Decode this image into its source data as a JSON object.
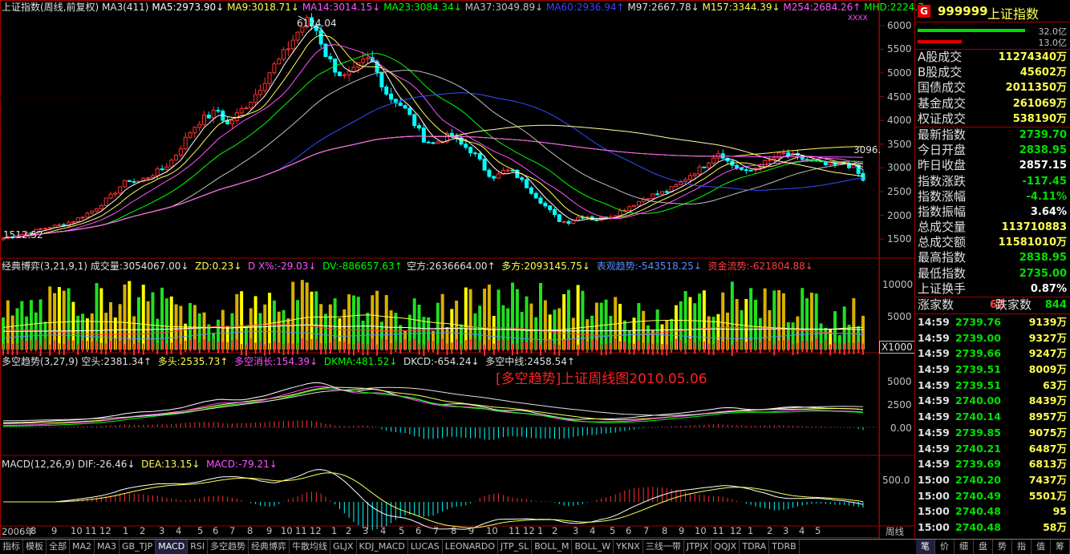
{
  "main_overlay": {
    "title": "上证指数(周线,前复权)",
    "ma3": "MA3(411)",
    "ma5": "MA5:2973.90↓",
    "ma9": "MA9:3018.71↓",
    "ma14": "MA14:3014.15↓",
    "ma23": "MA23:3084.34↓",
    "ma37": "MA37:3049.89↓",
    "ma60": "MA60:2936.94↑",
    "ma97": "M97:2667.78↓",
    "m157": "M157:3344.39↓",
    "m254": "M254:2684.26↑",
    "mhd": "MHD:2224.7:",
    "xxxx": "XXXX",
    "high_label": "6124.04",
    "low_label": "1512.52",
    "right_label": "3096."
  },
  "price_axis": [
    "6000",
    "5500",
    "5000",
    "4500",
    "4000",
    "3500",
    "3000",
    "2500",
    "2000",
    "1500"
  ],
  "vol_overlay": {
    "name": "经典博弈(3,21,9,1)",
    "vol": "成交量:3054067.00↓",
    "zd": "ZD:0.23↓",
    "dx": "D X%:-29.03↓",
    "dv": "DV:-886657.63↑",
    "kf": "空方:2636664.00↑",
    "df": "多方:2093145.75↓",
    "bx": "表观趋势:-543518.25↓",
    "zj": "资金流势:-621804.88↓"
  },
  "vol_axis": [
    "10000",
    "5000"
  ],
  "vol_unit": "X1000",
  "trend_overlay": {
    "name": "多空趋势(3,27,9)",
    "kt": "空头:2381.34↑",
    "dt": "多头:2535.73↑",
    "xz": "多空消长:154.39↓",
    "dkma": "DKMA:481.52↓",
    "dkcd": "DKCD:-654.24↓",
    "zx": "多空中线:2458.54↑"
  },
  "trend_caption": "[多空趋势]上证周线图2010.05.06",
  "trend_axis": [
    "5000",
    "2500",
    "0.00"
  ],
  "macd_overlay": {
    "name": "MACD(12,26,9)",
    "dif": "DIF:-26.46↓",
    "dea": "DEA:13.15↓",
    "macd": "MACD:-79.21↓"
  },
  "macd_axis": [
    "500.0"
  ],
  "x_axis": {
    "year": "2006年",
    "months": [
      "8",
      "9",
      "10",
      "11",
      "12",
      "1",
      "2",
      "3",
      "4",
      "5",
      "6",
      "7",
      "8",
      "9",
      "10",
      "11",
      "12",
      "1",
      "2",
      "3",
      "4",
      "5",
      "6",
      "7",
      "8",
      "9",
      "10",
      "11",
      "12",
      "1",
      "2",
      "3",
      "4",
      "5",
      "6",
      "7",
      "8",
      "9",
      "10",
      "11",
      "12",
      "1",
      "2",
      "3",
      "4",
      "5"
    ],
    "period": "周线"
  },
  "right_panel": {
    "code": "999999",
    "name": "上证指数",
    "g": "G",
    "bar1": "32.0亿",
    "bar2": "13.0亿",
    "stats": [
      {
        "l": "A股成交",
        "v": "11274340万",
        "c": "#ffff54"
      },
      {
        "l": "B股成交",
        "v": "45602万",
        "c": "#ffff54"
      },
      {
        "l": "国债成交",
        "v": "2011350万",
        "c": "#ffff54"
      },
      {
        "l": "基金成交",
        "v": "261069万",
        "c": "#ffff54"
      },
      {
        "l": "权证成交",
        "v": "538190万",
        "c": "#ffff54"
      }
    ],
    "quote": [
      {
        "l": "最新指数",
        "v": "2739.70",
        "c": "#00e000"
      },
      {
        "l": "今日开盘",
        "v": "2838.95",
        "c": "#00e000"
      },
      {
        "l": "昨日收盘",
        "v": "2857.15",
        "c": "#ffffff"
      },
      {
        "l": "指数涨跌",
        "v": "-117.45",
        "c": "#00e000"
      },
      {
        "l": "指数涨幅",
        "v": "-4.11%",
        "c": "#00e000"
      },
      {
        "l": "指数振幅",
        "v": "3.64%",
        "c": "#ffffff"
      },
      {
        "l": "总成交量",
        "v": "113710883",
        "c": "#ffff54"
      },
      {
        "l": "总成交额",
        "v": "11581010万",
        "c": "#ffff54"
      },
      {
        "l": "最高指数",
        "v": "2838.95",
        "c": "#00e000"
      },
      {
        "l": "最低指数",
        "v": "2735.00",
        "c": "#00e000"
      },
      {
        "l": "上证换手",
        "v": "0.87%",
        "c": "#ffffff"
      }
    ],
    "updown": {
      "up_l": "涨家数",
      "up": "62",
      "dn_l": "跌家数",
      "dn": "844"
    },
    "ticks": [
      {
        "t": "14:59",
        "p": "2739.76",
        "q": "9139万"
      },
      {
        "t": "14:59",
        "p": "2739.00",
        "q": "9327万"
      },
      {
        "t": "14:59",
        "p": "2739.66",
        "q": "9247万"
      },
      {
        "t": "14:59",
        "p": "2739.51",
        "q": "8009万"
      },
      {
        "t": "14:59",
        "p": "2739.51",
        "q": "63万"
      },
      {
        "t": "14:59",
        "p": "2740.00",
        "q": "8439万"
      },
      {
        "t": "14:59",
        "p": "2740.14",
        "q": "8957万"
      },
      {
        "t": "14:59",
        "p": "2739.85",
        "q": "9075万"
      },
      {
        "t": "14:59",
        "p": "2740.21",
        "q": "6487万"
      },
      {
        "t": "14:59",
        "p": "2739.69",
        "q": "6813万"
      },
      {
        "t": "15:00",
        "p": "2740.20",
        "q": "7437万"
      },
      {
        "t": "15:00",
        "p": "2740.49",
        "q": "5501万"
      },
      {
        "t": "15:00",
        "p": "2740.48",
        "q": "95"
      },
      {
        "t": "15:00",
        "p": "2740.48",
        "q": "58万"
      },
      {
        "t": "15:01",
        "p": "2739.70",
        "q": "2"
      }
    ]
  },
  "tabs": [
    "指标",
    "模板",
    "全部",
    "MA2",
    "MA3",
    "GB_TJP",
    "MACD",
    "RSI",
    "多空趋势",
    "经典博弈",
    "牛散均线",
    "GLJX",
    "KDJ_MACD",
    "LUCAS",
    "LEONARDO",
    "JTP_SL",
    "BOLL_M",
    "BOLL_W",
    "YKNX",
    "三线一带",
    "JTPJX",
    "QQJX",
    "TDRA",
    "TDRB"
  ],
  "right_tabs": [
    "笔",
    "价",
    "细",
    "盘",
    "势",
    "指",
    "值",
    "筹"
  ],
  "chart_data": {
    "type": "candlestick",
    "period": "weekly",
    "x_range": [
      "2006-08",
      "2010-05"
    ],
    "ylim": [
      1300,
      6300
    ],
    "key_points": [
      {
        "label": "high",
        "value": 6124.04
      },
      {
        "label": "low",
        "value": 1512.52
      },
      {
        "label": "last",
        "value": 2739.7
      }
    ],
    "price_path": [
      1520,
      1560,
      1600,
      1650,
      1700,
      1750,
      1780,
      1820,
      1900,
      2000,
      2100,
      2250,
      2400,
      2600,
      2750,
      2700,
      2800,
      2900,
      3000,
      3200,
      3500,
      3800,
      4000,
      4100,
      4200,
      3900,
      4100,
      4300,
      4500,
      4800,
      5100,
      5300,
      5600,
      5900,
      6100,
      5900,
      5400,
      5100,
      4900,
      5000,
      5200,
      5300,
      4900,
      4500,
      4400,
      4200,
      3900,
      3600,
      3500,
      3600,
      3700,
      3500,
      3400,
      3200,
      2900,
      2800,
      2950,
      2900,
      2700,
      2500,
      2300,
      2100,
      1900,
      1850,
      1950,
      2000,
      1900,
      1950,
      2000,
      2100,
      2200,
      2300,
      2400,
      2450,
      2500,
      2600,
      2750,
      2900,
      3000,
      3200,
      3350,
      3100,
      3000,
      2900,
      3000,
      3100,
      3200,
      3300,
      3250,
      3200,
      3150,
      3100,
      3050,
      3050,
      3100,
      3000,
      2740
    ]
  }
}
